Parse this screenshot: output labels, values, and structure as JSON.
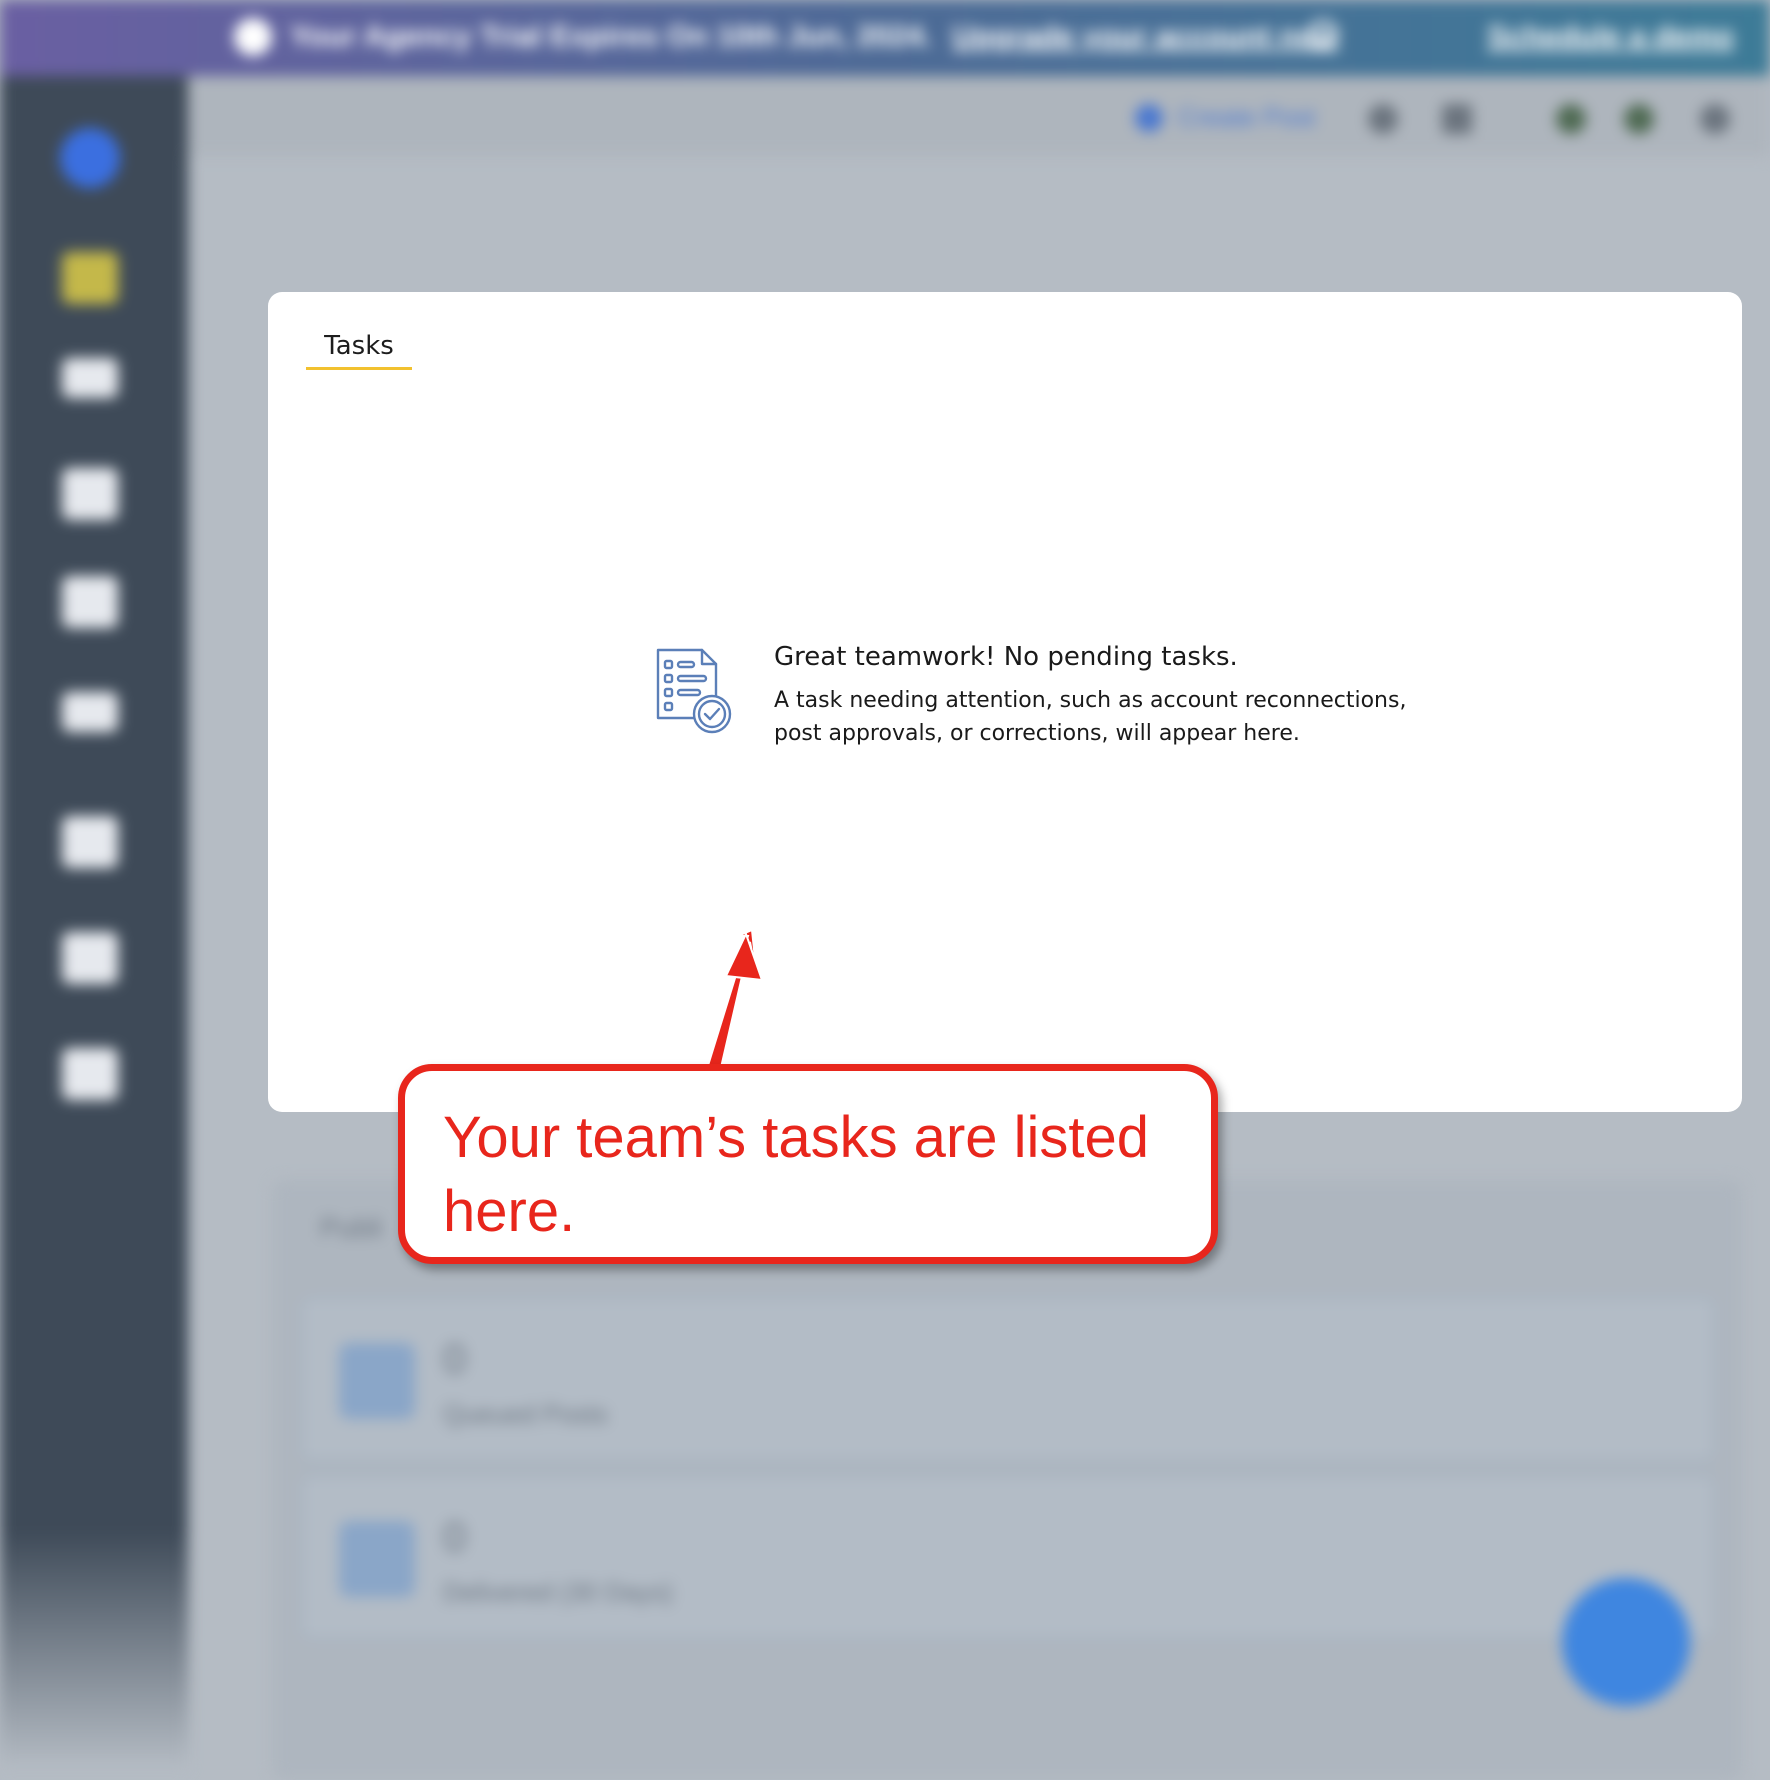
{
  "banner": {
    "text": "Your Agency Trial Expires On 10th Jun, 2024.",
    "upgrade_link": "Upgrade your account now",
    "demo_link": "Schedule a demo"
  },
  "topbar": {
    "create_post_label": "Create Post"
  },
  "background_panel": {
    "tab_label": "Publi",
    "stats": [
      {
        "value": "0",
        "label": "Queued Posts"
      },
      {
        "value": "0",
        "label": "Delivered (30 Days)"
      }
    ]
  },
  "modal": {
    "tab_label": "Tasks",
    "empty_title": "Great teamwork! No pending tasks.",
    "empty_desc_line1": "A task needing attention, such as account reconnections,",
    "empty_desc_line2": "post approvals, or corrections, will appear here."
  },
  "annotation": {
    "text": "Your team’s tasks are listed here.",
    "color": "#e8261c"
  },
  "colors": {
    "tab_underline": "#f2c12e",
    "icon_blue": "#5b7fb8",
    "sidebar": "#3e4a58"
  }
}
